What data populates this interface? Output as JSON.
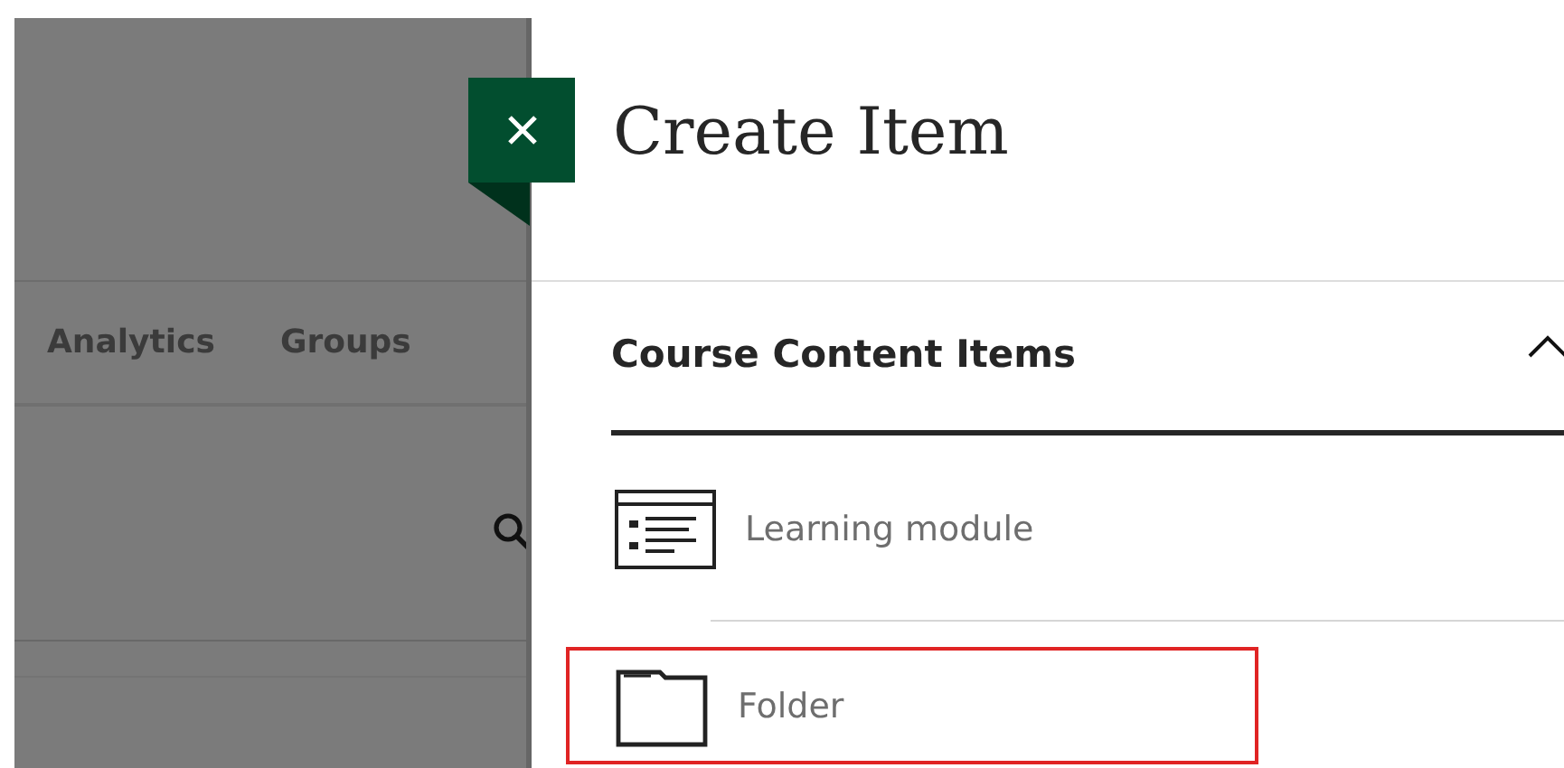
{
  "background": {
    "nav": [
      "Analytics",
      "Groups"
    ]
  },
  "panel": {
    "title": "Create Item",
    "section": {
      "title": "Course Content Items",
      "expanded": true,
      "items": [
        {
          "label": "Learning module",
          "kind": "module",
          "highlighted": false
        },
        {
          "label": "Folder",
          "kind": "folder",
          "highlighted": true
        }
      ]
    }
  }
}
